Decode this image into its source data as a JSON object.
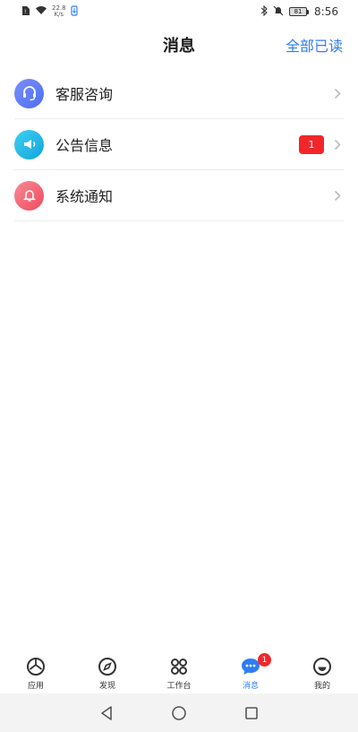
{
  "status_bar": {
    "speed_value": "22.8",
    "speed_unit": "K/s",
    "battery_level": "81",
    "time": "8:56"
  },
  "header": {
    "title": "消息",
    "mark_all_read": "全部已读"
  },
  "messages": [
    {
      "label": "客服咨询",
      "icon": "headset-icon",
      "color": "#5b7cf7"
    },
    {
      "label": "公告信息",
      "icon": "megaphone-icon",
      "color": "#1fb8e6",
      "badge": "1"
    },
    {
      "label": "系统通知",
      "icon": "bell-icon",
      "color": "#f05a6a"
    }
  ],
  "tabs": [
    {
      "label": "应用",
      "icon": "aperture-icon"
    },
    {
      "label": "发现",
      "icon": "compass-icon"
    },
    {
      "label": "工作台",
      "icon": "grid-icon"
    },
    {
      "label": "消息",
      "icon": "chat-bubble-icon",
      "active": true,
      "badge": "1"
    },
    {
      "label": "我的",
      "icon": "profile-icon"
    }
  ],
  "colors": {
    "accent": "#2f7cf6",
    "badge": "#f0262b"
  }
}
